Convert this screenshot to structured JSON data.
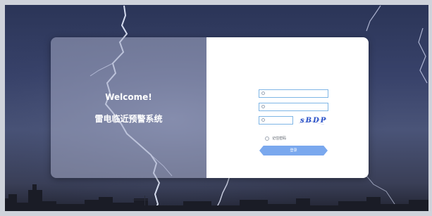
{
  "left_panel": {
    "welcome": "Welcome!",
    "system_title": "雷电临近预警系统"
  },
  "form": {
    "username": {
      "placeholder": "",
      "value": "",
      "icon": "user-icon"
    },
    "password": {
      "placeholder": "",
      "value": "",
      "icon": "lock-icon"
    },
    "captcha_input": {
      "placeholder": "",
      "value": "",
      "icon": "shield-icon"
    },
    "captcha_text": "sBDP",
    "remember_label": "记住密码",
    "login_label": "登录"
  },
  "colors": {
    "accent": "#7aa8ee",
    "field_border": "#7fb6e6",
    "captcha": "#2850c8"
  }
}
